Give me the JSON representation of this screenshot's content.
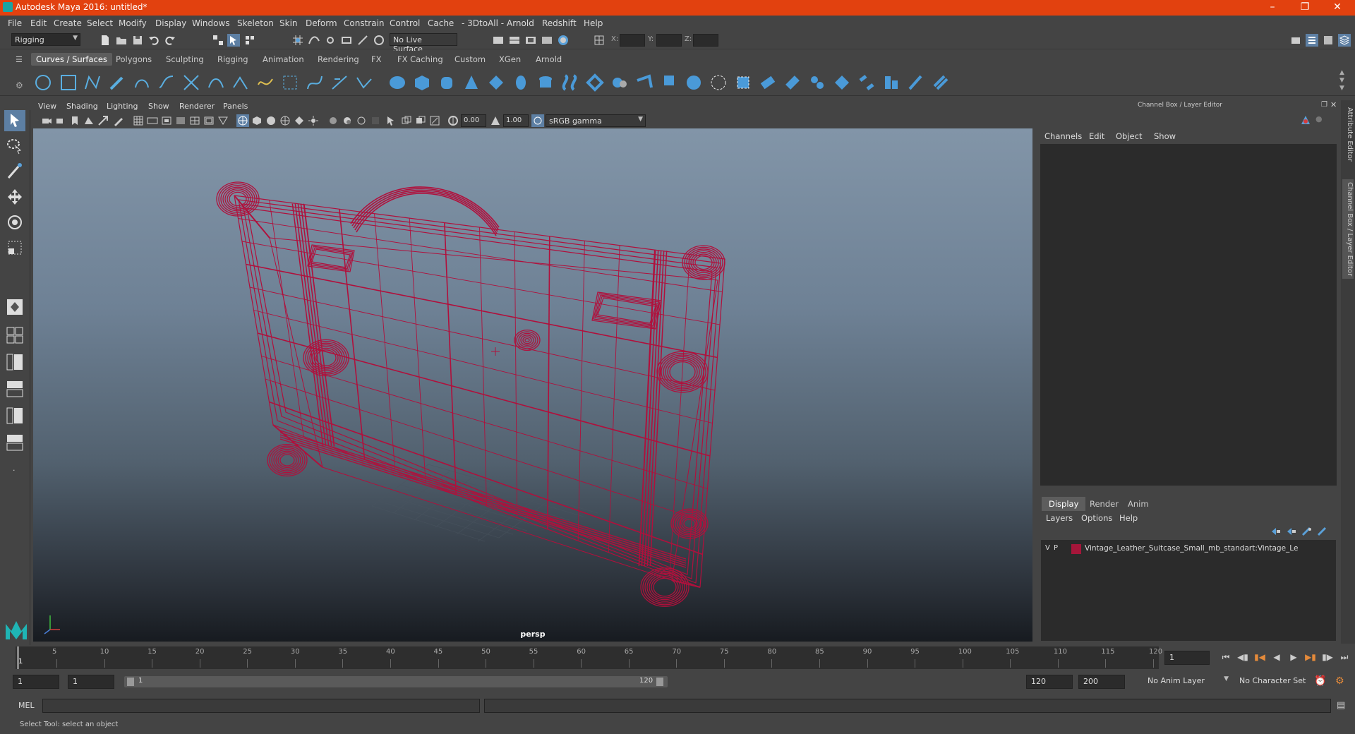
{
  "title": "Autodesk Maya 2016: untitled*",
  "menus": [
    "File",
    "Edit",
    "Create",
    "Select",
    "Modify",
    "Display",
    "Windows",
    "Skeleton",
    "Skin",
    "Deform",
    "Constrain",
    "Control",
    "Cache",
    "- 3DtoAll -",
    "Arnold",
    "Redshift",
    "Help"
  ],
  "statusline": {
    "mode": "Rigging",
    "live_surface": "No Live Surface",
    "x_label": "X:",
    "y_label": "Y:",
    "z_label": "Z:"
  },
  "shelf_tabs": [
    "Curves / Surfaces",
    "Polygons",
    "Sculpting",
    "Rigging",
    "Animation",
    "Rendering",
    "FX",
    "FX Caching",
    "Custom",
    "XGen",
    "Arnold"
  ],
  "viewport": {
    "menus": [
      "View",
      "Shading",
      "Lighting",
      "Show",
      "Renderer",
      "Panels"
    ],
    "exposure": "0.00",
    "gamma": "1.00",
    "color_space": "sRGB gamma",
    "camera": "persp"
  },
  "channel_box": {
    "title": "Channel Box / Layer Editor",
    "menus": [
      "Channels",
      "Edit",
      "Object",
      "Show"
    ]
  },
  "layer_editor": {
    "tabs": [
      "Display",
      "Render",
      "Anim"
    ],
    "menus": [
      "Layers",
      "Options",
      "Help"
    ],
    "layer": {
      "v": "V",
      "p": "P",
      "name": "Vintage_Leather_Suitcase_Small_mb_standart:Vintage_Le",
      "color": "#a5163a"
    }
  },
  "side_tabs": [
    "Attribute Editor",
    "Channel Box / Layer Editor"
  ],
  "timeline": {
    "ticks": [
      5,
      10,
      15,
      20,
      25,
      30,
      35,
      40,
      45,
      50,
      55,
      60,
      65,
      70,
      75,
      80,
      85,
      90,
      95,
      100,
      105,
      110,
      115,
      120
    ],
    "start_marker": "1",
    "current_frame": "1"
  },
  "range": {
    "start": "1",
    "start_inner": "1",
    "slider_start": "1",
    "slider_end": "120",
    "end_inner": "120",
    "end": "200",
    "anim_layer": "No Anim Layer",
    "char_set": "No Character Set"
  },
  "cmd": {
    "label": "MEL"
  },
  "help_line": "Select Tool: select an object",
  "wire_color": "#b0103c"
}
